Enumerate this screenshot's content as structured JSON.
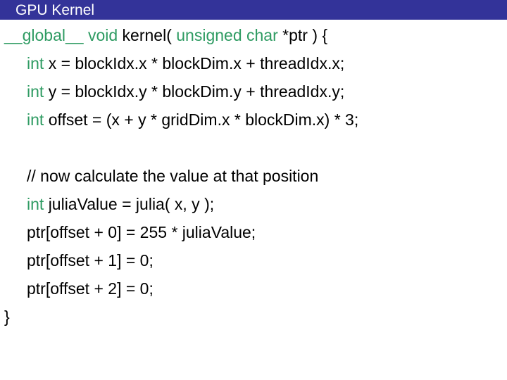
{
  "slide": {
    "title": "GPU Kernel",
    "title_bar_color": "#333399",
    "title_text_color": "#FFFFFF",
    "background_color": "#FFFFFF",
    "keyword_color": "#2E9B62",
    "text_color": "#000000"
  },
  "code": {
    "lines": [
      {
        "indent": false,
        "tokens": [
          {
            "text": "__global__",
            "kind": "kw"
          },
          {
            "text": " void ",
            "kind": "kw"
          },
          {
            "text": "kernel( ",
            "kind": "plain"
          },
          {
            "text": "unsigned char ",
            "kind": "kw"
          },
          {
            "text": "*ptr ) {",
            "kind": "plain"
          }
        ]
      },
      {
        "indent": true,
        "tokens": [
          {
            "text": "int ",
            "kind": "kw"
          },
          {
            "text": "x = blockIdx.x * blockDim.x + threadIdx.x;",
            "kind": "plain"
          }
        ]
      },
      {
        "indent": true,
        "tokens": [
          {
            "text": "int ",
            "kind": "kw"
          },
          {
            "text": "y = blockIdx.y * blockDim.y + threadIdx.y;",
            "kind": "plain"
          }
        ]
      },
      {
        "indent": true,
        "tokens": [
          {
            "text": "int ",
            "kind": "kw"
          },
          {
            "text": "offset = (x + y * gridDim.x * blockDim.x) * 3;",
            "kind": "plain"
          }
        ]
      },
      {
        "indent": true,
        "blank": true,
        "tokens": []
      },
      {
        "indent": true,
        "tokens": [
          {
            "text": "// now calculate the value at that position",
            "kind": "cmt"
          }
        ]
      },
      {
        "indent": true,
        "tokens": [
          {
            "text": "int ",
            "kind": "kw"
          },
          {
            "text": "juliaValue = julia( x, y );",
            "kind": "plain"
          }
        ]
      },
      {
        "indent": true,
        "tokens": [
          {
            "text": "ptr[offset + 0] = 255 * juliaValue;",
            "kind": "plain"
          }
        ]
      },
      {
        "indent": true,
        "tokens": [
          {
            "text": "ptr[offset + 1] = 0;",
            "kind": "plain"
          }
        ]
      },
      {
        "indent": true,
        "tokens": [
          {
            "text": "ptr[offset + 2] = 0;",
            "kind": "plain"
          }
        ]
      },
      {
        "indent": false,
        "tokens": [
          {
            "text": "}",
            "kind": "plain"
          }
        ]
      }
    ]
  }
}
